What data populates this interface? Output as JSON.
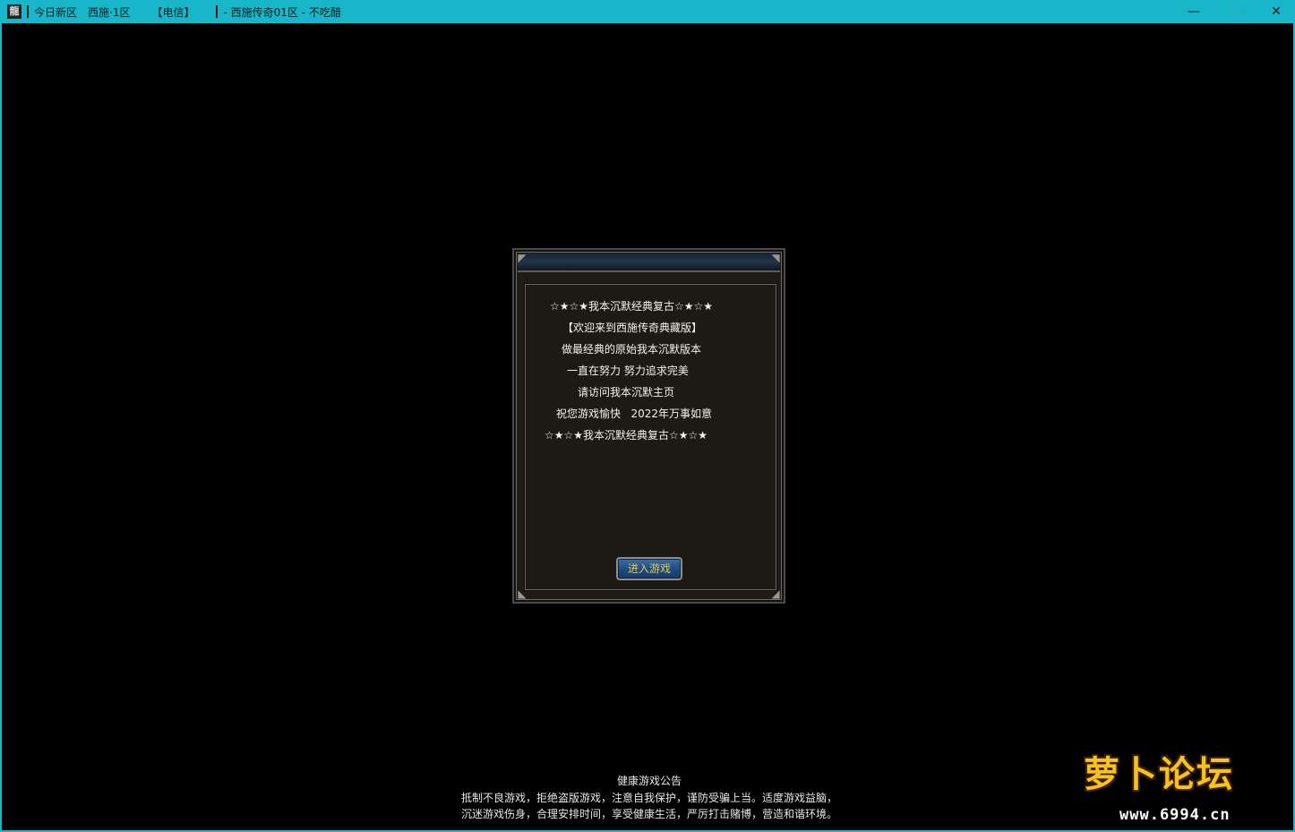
{
  "titlebar": {
    "app_icon_glyph": "龍",
    "segments": [
      "今日新区",
      "西施·1区",
      "【电信】",
      "- 西施传奇01区 - 不吃醋"
    ],
    "minimize": "—",
    "maximize": "☐",
    "close": "✕"
  },
  "dialog": {
    "lines": [
      "☆★☆★我本沉默经典复古☆★☆★",
      "【欢迎来到西施传奇典藏版】",
      "做最经典的原始我本沉默版本",
      "一直在努力 努力追求完美",
      "请访问我本沉默主页",
      "祝您游戏愉快   2022年万事如意",
      "☆★☆★我本沉默经典复古☆★☆★"
    ],
    "enter_button": "进入游戏"
  },
  "notice": {
    "title": "健康游戏公告",
    "line1": "抵制不良游戏，拒绝盗版游戏，注意自我保护，谨防受骗上当。适度游戏益脑，",
    "line2": "沉迷游戏伤身，合理安排时间，享受健康生活，严厉打击赌博，营造和谐环境。"
  },
  "watermark": {
    "brand": "萝卜论坛",
    "url": "www.6994.cn"
  }
}
